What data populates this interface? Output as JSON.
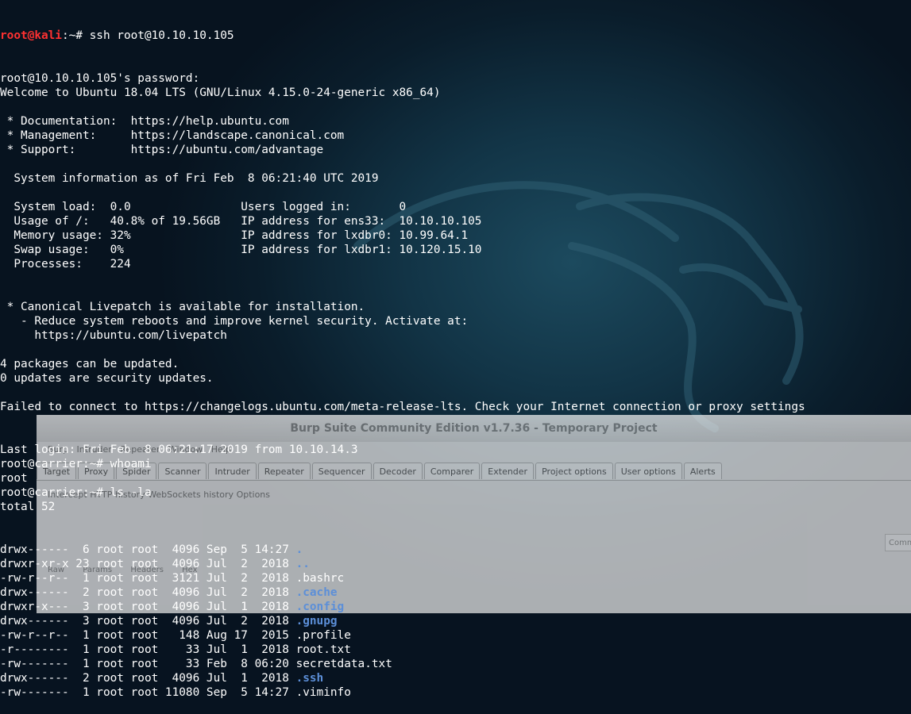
{
  "burp": {
    "title": "Burp Suite Community Edition v1.7.36 - Temporary Project",
    "menu": [
      "Burp",
      "Intruder",
      "Repeater",
      "Window",
      "Help"
    ],
    "tabs": [
      "Target",
      "Proxy",
      "Spider",
      "Scanner",
      "Intruder",
      "Repeater",
      "Sequencer",
      "Decoder",
      "Comparer",
      "Extender",
      "Project options",
      "User options",
      "Alerts"
    ],
    "subtabs": [
      "Intercept",
      "HTTP history",
      "WebSockets history",
      "Options"
    ],
    "viewtabs": [
      "Raw",
      "Params",
      "Headers",
      "Hex"
    ],
    "field_text": "Comm"
  },
  "terminal": {
    "prompt_user": "root@kali",
    "prompt_path": ":~# ",
    "ssh_cmd": "ssh root@10.10.10.105",
    "lines": [
      "root@10.10.10.105's password: ",
      "Welcome to Ubuntu 18.04 LTS (GNU/Linux 4.15.0-24-generic x86_64)",
      "",
      " * Documentation:  https://help.ubuntu.com",
      " * Management:     https://landscape.canonical.com",
      " * Support:        https://ubuntu.com/advantage",
      "",
      "  System information as of Fri Feb  8 06:21:40 UTC 2019",
      "",
      "  System load:  0.0                Users logged in:       0",
      "  Usage of /:   40.8% of 19.56GB   IP address for ens33:  10.10.10.105",
      "  Memory usage: 32%                IP address for lxdbr0: 10.99.64.1",
      "  Swap usage:   0%                 IP address for lxdbr1: 10.120.15.10",
      "  Processes:    224",
      "",
      "",
      " * Canonical Livepatch is available for installation.",
      "   - Reduce system reboots and improve kernel security. Activate at:",
      "     https://ubuntu.com/livepatch",
      "",
      "4 packages can be updated.",
      "0 updates are security updates.",
      "",
      "Failed to connect to https://changelogs.ubuntu.com/meta-release-lts. Check your Internet connection or proxy settings",
      "",
      "",
      "Last login: Fri Feb  8 06:21:17 2019 from 10.10.14.3",
      "root@carrier:~# whoami",
      "root",
      "root@carrier:~# ls -la",
      "total 52"
    ],
    "listing": [
      {
        "meta": "drwx------  6 root root  4096 Sep  5 14:27 ",
        "name": ".",
        "dir": true
      },
      {
        "meta": "drwxr-xr-x 23 root root  4096 Jul  2  2018 ",
        "name": "..",
        "dir": true
      },
      {
        "meta": "-rw-r--r--  1 root root  3121 Jul  2  2018 ",
        "name": ".bashrc",
        "dir": false
      },
      {
        "meta": "drwx------  2 root root  4096 Jul  2  2018 ",
        "name": ".cache",
        "dir": true
      },
      {
        "meta": "drwxr-x---  3 root root  4096 Jul  1  2018 ",
        "name": ".config",
        "dir": true
      },
      {
        "meta": "drwx------  3 root root  4096 Jul  2  2018 ",
        "name": ".gnupg",
        "dir": true
      },
      {
        "meta": "-rw-r--r--  1 root root   148 Aug 17  2015 ",
        "name": ".profile",
        "dir": false
      },
      {
        "meta": "-r--------  1 root root    33 Jul  1  2018 ",
        "name": "root.txt",
        "dir": false
      },
      {
        "meta": "-rw-------  1 root root    33 Feb  8 06:20 ",
        "name": "secretdata.txt",
        "dir": false
      },
      {
        "meta": "drwx------  2 root root  4096 Jul  1  2018 ",
        "name": ".ssh",
        "dir": true
      },
      {
        "meta": "-rw-------  1 root root 11080 Sep  5 14:27 ",
        "name": ".viminfo",
        "dir": false
      }
    ]
  }
}
